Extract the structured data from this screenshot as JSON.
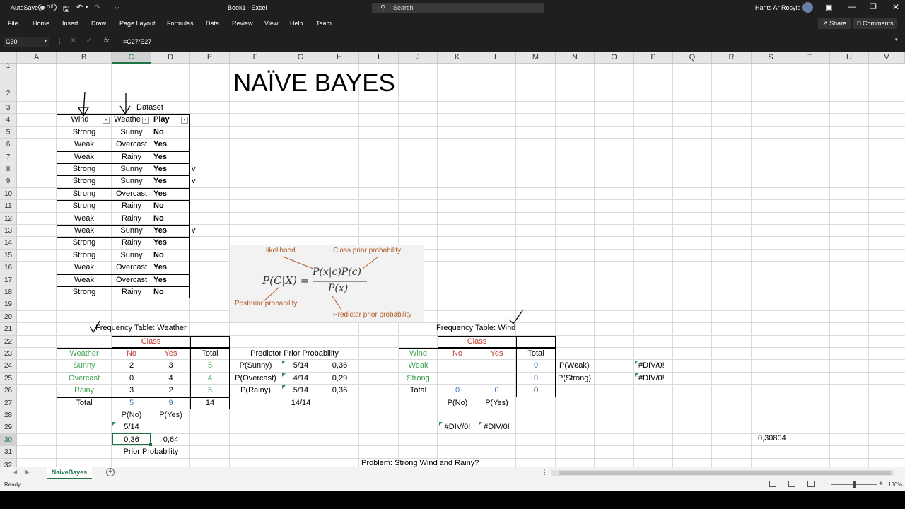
{
  "titlebar": {
    "autosave_label": "AutoSave",
    "autosave_state": "Off",
    "doc_title": "Book1  -  Excel",
    "search_placeholder": "Search",
    "user_name": "Harits Ar Rosyid"
  },
  "ribbon": {
    "tabs": [
      "File",
      "Home",
      "Insert",
      "Draw",
      "Page Layout",
      "Formulas",
      "Data",
      "Review",
      "View",
      "Help",
      "Team"
    ],
    "share_label": "Share",
    "comments_label": "Comments"
  },
  "formula_bar": {
    "name_box": "C30",
    "fx_label": "fx",
    "formula": "=C27/E27"
  },
  "columns": [
    "A",
    "B",
    "C",
    "D",
    "E",
    "F",
    "G",
    "H",
    "I",
    "J",
    "K",
    "L",
    "M",
    "N",
    "O",
    "P",
    "Q",
    "R",
    "S",
    "T",
    "U",
    "V"
  ],
  "rows": [
    "1",
    "2",
    "3",
    "4",
    "5",
    "6",
    "7",
    "8",
    "9",
    "10",
    "11",
    "12",
    "13",
    "14",
    "15",
    "16",
    "17",
    "18",
    "19",
    "20",
    "21",
    "22",
    "23",
    "24",
    "25",
    "26",
    "27",
    "28",
    "29",
    "30",
    "31",
    "32"
  ],
  "sheet": {
    "title": "NAÏVE BAYES",
    "dataset_label": "Dataset",
    "dataset_headers": [
      "Wind",
      "Weathe",
      "Play"
    ],
    "dataset_rows": [
      [
        "Strong",
        "Sunny",
        "No"
      ],
      [
        "Weak",
        "Overcast",
        "Yes"
      ],
      [
        "Weak",
        "Rainy",
        "Yes"
      ],
      [
        "Strong",
        "Sunny",
        "Yes"
      ],
      [
        "Strong",
        "Sunny",
        "Yes"
      ],
      [
        "Strong",
        "Overcast",
        "Yes"
      ],
      [
        "Strong",
        "Rainy",
        "No"
      ],
      [
        "Weak",
        "Rainy",
        "No"
      ],
      [
        "Weak",
        "Sunny",
        "Yes"
      ],
      [
        "Strong",
        "Rainy",
        "Yes"
      ],
      [
        "Strong",
        "Sunny",
        "No"
      ],
      [
        "Weak",
        "Overcast",
        "Yes"
      ],
      [
        "Weak",
        "Overcast",
        "Yes"
      ],
      [
        "Strong",
        "Rainy",
        "No"
      ]
    ],
    "v_marks": [
      "v",
      "v",
      "v"
    ],
    "freq_weather": {
      "title": "Frequency Table: Weather",
      "class_label": "Class",
      "headers": [
        "Weather",
        "No",
        "Yes",
        "Total"
      ],
      "rows": [
        [
          "Sunny",
          "2",
          "3",
          "5"
        ],
        [
          "Overcast",
          "0",
          "4",
          "4"
        ],
        [
          "Rainy",
          "3",
          "2",
          "5"
        ],
        [
          "Total",
          "5",
          "9",
          "14"
        ]
      ],
      "p_no_label": "P(No)",
      "p_yes_label": "P(Yes)",
      "p_no_fraction": "5/14",
      "p_no_value": "0,36",
      "p_yes_value": "0,64",
      "prior_label": "Prior Probability"
    },
    "predictor": {
      "title": "Predictor Prior Probability",
      "rows": [
        [
          "P(Sunny)",
          "5/14",
          "0,36"
        ],
        [
          "P(Overcast)",
          "4/14",
          "0,29"
        ],
        [
          "P(Rainy)",
          "5/14",
          "0,36"
        ]
      ],
      "total": "14/14"
    },
    "formula_image": {
      "likelihood": "likelihood",
      "class_prior": "Class prior probability",
      "posterior": "Posterior probability",
      "predictor_prior": "Predictor prior probability",
      "lhs": "P(C|X) =",
      "numerator": "P(x|c)P(c)",
      "denominator": "P(x)"
    },
    "freq_wind": {
      "title": "Frequency Table: Wind",
      "class_label": "Class",
      "headers": [
        "Wind",
        "No",
        "Yes",
        "Total"
      ],
      "rows": [
        [
          "Weak",
          "",
          "",
          "0"
        ],
        [
          "Strong",
          "",
          "",
          "0"
        ],
        [
          "Total",
          "0",
          "0",
          "0"
        ]
      ],
      "p_no_label": "P(No)",
      "p_yes_label": "P(Yes)",
      "div_no": "#DIV/0!",
      "div_yes": "#DIV/0!",
      "p_weak_label": "P(Weak)",
      "p_strong_label": "P(Strong)",
      "p_weak_value": "#DIV/0!",
      "p_strong_value": "#DIV/0!"
    },
    "s30_value": "0,30804",
    "problem_text": "Problem: Strong Wind and Rainy?"
  },
  "tabs": {
    "sheet_name": "NaiveBayes"
  },
  "status": {
    "ready": "Ready",
    "zoom": "130%"
  },
  "colors": {
    "excel_green": "#217346",
    "header_green": "#3aa14b",
    "class_red": "#c0392b",
    "value_blue": "#3670b5",
    "annotation_orange": "#b15a26"
  }
}
